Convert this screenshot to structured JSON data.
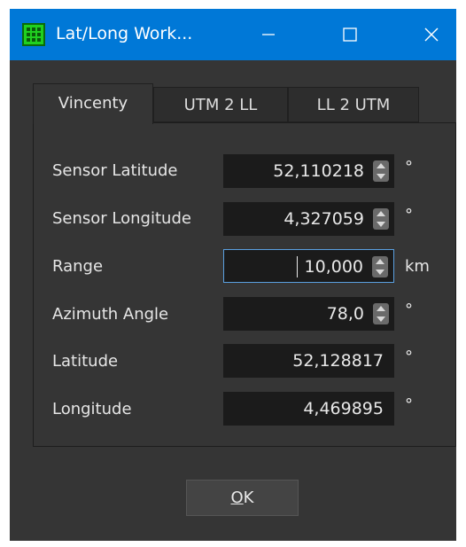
{
  "window": {
    "title": "Lat/Long Work..."
  },
  "tabs": [
    {
      "label": "Vincenty",
      "active": true
    },
    {
      "label": "UTM 2 LL",
      "active": false
    },
    {
      "label": "LL 2 UTM",
      "active": false
    }
  ],
  "fields": {
    "sensor_latitude": {
      "label": "Sensor Latitude",
      "value": "52,110218",
      "unit": "°"
    },
    "sensor_longitude": {
      "label": "Sensor Longitude",
      "value": "4,327059",
      "unit": "°"
    },
    "range": {
      "label": "Range",
      "value": "10,000",
      "unit": "km"
    },
    "azimuth_angle": {
      "label": "Azimuth Angle",
      "value": "78,0",
      "unit": "°"
    },
    "latitude": {
      "label": "Latitude",
      "value": "52,128817",
      "unit": "°"
    },
    "longitude": {
      "label": "Longitude",
      "value": "4,469895",
      "unit": "°"
    }
  },
  "buttons": {
    "ok_mnemonic": "O",
    "ok_rest": "K"
  },
  "icons": {
    "app": "grid-app-icon",
    "minimize": "minimize-icon",
    "maximize": "maximize-icon",
    "close": "close-icon"
  },
  "colors": {
    "titlebar": "#0078d7",
    "window_bg": "#353535",
    "field_bg": "#1b1b1b",
    "focus_border": "#5aa0e0"
  }
}
